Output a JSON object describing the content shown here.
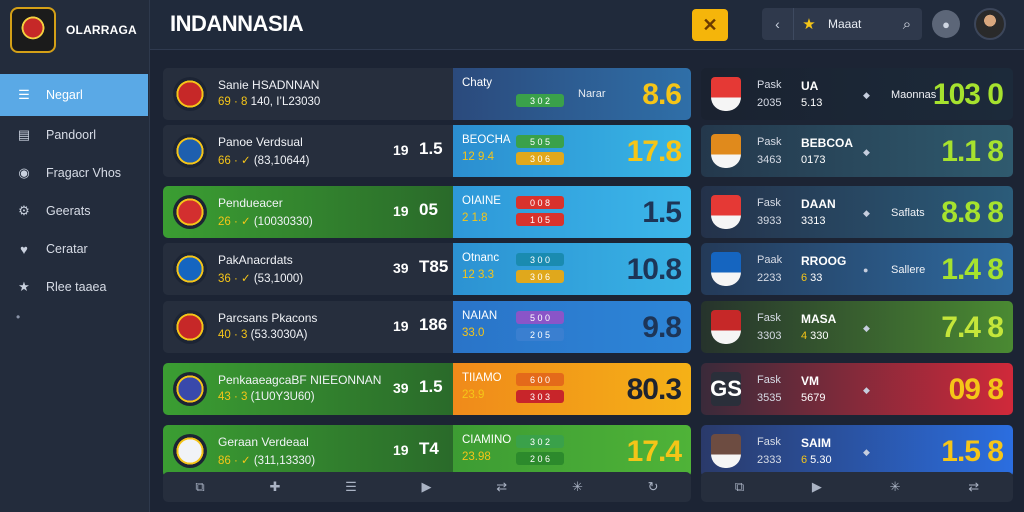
{
  "app": {
    "brand": "OLARRAGA",
    "title": "INDANNASIA"
  },
  "header": {
    "alert_icon": "✕",
    "back_icon": "‹",
    "star_icon": "★",
    "label": "Maaat",
    "search_icon": "⌕",
    "notif_icon": "●"
  },
  "sidebar": {
    "items": [
      {
        "label": "Negarl",
        "icon": "☰",
        "active": true
      },
      {
        "label": "Pandoorl",
        "icon": "▤",
        "active": false
      },
      {
        "label": "Fragacr Vhos",
        "icon": "◉",
        "active": false
      },
      {
        "label": "Geerats",
        "icon": "⚙",
        "active": false
      },
      {
        "label": "Ceratar",
        "icon": "♥",
        "active": false
      },
      {
        "label": "Rlee taaea",
        "icon": "★",
        "active": false
      }
    ],
    "extra": "•"
  },
  "matches": [
    {
      "team": "Sanie HSADNNAN",
      "sub_y": "69 · 8",
      "sub": "140, I’L23030",
      "score1": "",
      "score2": "",
      "odds_tag": "Chaty",
      "odds_tag2": "",
      "pill1": "3 0 2",
      "pill2": "",
      "odds_word": "Narar",
      "odds_big": "8.6",
      "crest": "#c62828",
      "bg": "linear-gradient(90deg,#2b4a7c,#2f6fa8)",
      "big_color": "#f5c518",
      "pill1_color": "#3aa14a",
      "pill2_color": ""
    },
    {
      "team": "Panoe Verdsual",
      "sub_y": "66 · ✓",
      "sub": "(83,10644)",
      "score1": "19",
      "score2": "1.5",
      "odds_tag": "BEOCHA",
      "odds_tag2": "12 9.4",
      "pill1": "5 0 5",
      "pill2": "3 0 6",
      "odds_word": "",
      "odds_big": "17.8",
      "crest": "#1e5fae",
      "bg": "linear-gradient(90deg,#2b8ed0,#38b6e6)",
      "big_color": "#f5c518",
      "pill1_color": "#3aa14a",
      "pill2_color": "#e0a81c"
    },
    {
      "team": "Pendueacer",
      "sub_y": "26 · ✓",
      "sub": "(10030330)",
      "score1": "19",
      "score2": "05",
      "odds_tag": "OIAINE",
      "odds_tag2": "2 1.8",
      "pill1": "0 0 8",
      "pill2": "1 0 5",
      "odds_word": "",
      "odds_big": "1.5",
      "crest": "#d32f2f",
      "bg": "linear-gradient(90deg,#2e98d8,#3cb7ea)",
      "big_color": "#1d3557",
      "pill1_color": "#d9322c",
      "pill2_color": "#d9322c"
    },
    {
      "team": "PakAnacrdats",
      "sub_y": "36 · ✓",
      "sub": "(53,1000)",
      "score1": "39",
      "score2": "T85",
      "odds_tag": "Otnanc",
      "odds_tag2": "12 3.3",
      "pill1": "3 0 0",
      "pill2": "3 0 6",
      "odds_word": "",
      "odds_big": "10.8",
      "crest": "#1565c0",
      "bg": "linear-gradient(90deg,#2c92d2,#39b3e6)",
      "big_color": "#1d3557",
      "pill1_color": "#1a8bb0",
      "pill2_color": "#e0a81c"
    },
    {
      "team": "Parcsans Pkacons",
      "sub_y": "40 · 3",
      "sub": "(53.3030A)",
      "score1": "19",
      "score2": "186",
      "odds_tag": "NAIAN",
      "odds_tag2": "33.0",
      "pill1": "5 0 0",
      "pill2": "2 0 5",
      "odds_word": "",
      "odds_big": "9.8",
      "crest": "#c62828",
      "bg": "linear-gradient(90deg,#2a74c8,#2d86d8)",
      "big_color": "#1d3557",
      "pill1_color": "#8a55c8",
      "pill2_color": "#3a7fd0"
    },
    {
      "team": "PenkaaeagcaBF NIEEONNAN",
      "sub_y": "43 · 3",
      "sub": "(1U0Y3U60)",
      "score1": "39",
      "score2": "1.5",
      "odds_tag": "TIIAMO",
      "odds_tag2": "23.9",
      "pill1": "6 0 0",
      "pill2": "3 0 3",
      "odds_word": "",
      "odds_big": "80.3",
      "crest": "#3949ab",
      "bg": "linear-gradient(90deg,#f08a1a,#f5b117)",
      "big_color": "#1d2330",
      "pill1_color": "#e46a1a",
      "pill2_color": "#c8252a"
    },
    {
      "team": "Geraan Verdeaal",
      "sub_y": "86 · ✓",
      "sub": "(311,13330)",
      "score1": "19",
      "score2": "T4",
      "odds_tag": "CIAMINO",
      "odds_tag2": "23.98",
      "pill1": "3 0 2",
      "pill2": "2 0 6",
      "odds_word": "",
      "odds_big": "17.4",
      "crest": "#f1f3f7",
      "bg": "linear-gradient(90deg,#3d9c33,#4fb338)",
      "big_color": "#f5c518",
      "pill1_color": "#3aa14a",
      "pill2_color": "#2c8a2c"
    }
  ],
  "right_matches": [
    {
      "tag": "Pask",
      "tag2": "2035",
      "name": "UA",
      "sub": "5.13",
      "sub_y": "",
      "word": "Maonnas",
      "big": "103 0",
      "crest": "#e53935",
      "bg": "linear-gradient(90deg,#1a2230,#1c2a3a)",
      "big_color": "#a6e22e",
      "dot": "◆"
    },
    {
      "tag": "Pask",
      "tag2": "3463",
      "name": "BEBCOA",
      "sub": "0173",
      "sub_y": "",
      "word": "",
      "big": "1.1 8",
      "crest": "#e08a1c",
      "bg": "linear-gradient(90deg,#24384c,#2f5a6e)",
      "big_color": "#a6e22e",
      "dot": "◆"
    },
    {
      "tag": "Fask",
      "tag2": "3933",
      "name": "DAAN",
      "sub": "3313",
      "sub_y": "",
      "word": "Saflats",
      "big": "8.8 8",
      "crest": "#e53935",
      "bg": "linear-gradient(90deg,#24324a,#2b5c7a)",
      "big_color": "#a6e22e",
      "dot": "◆"
    },
    {
      "tag": "Paak",
      "tag2": "2233",
      "name": "RROOG",
      "sub": "33",
      "sub_y": "6",
      "word": "Sallere",
      "big": "1.4 8",
      "crest": "#1565c0",
      "bg": "linear-gradient(90deg,#243a58,#2e6aa0)",
      "big_color": "#a6e22e",
      "dot": "●"
    },
    {
      "tag": "Fask",
      "tag2": "3303",
      "name": "MASA",
      "sub": "330",
      "sub_y": "4",
      "word": "",
      "big": "7.4 8",
      "crest": "#c62828",
      "bg": "linear-gradient(90deg,#26332c,#4a8a32)",
      "big_color": "#c5e63a",
      "dot": "◆"
    },
    {
      "tag": "Fask",
      "tag2": "3535",
      "name": "VM",
      "sub": "5679",
      "sub_y": "",
      "word": "",
      "big": "09 8",
      "crest": "#2a2f3a",
      "crest_text": "GS",
      "bg": "linear-gradient(90deg,#3a2a3a,#d0293a)",
      "big_color": "#f5c518",
      "dot": "◆"
    },
    {
      "tag": "Fask",
      "tag2": "2333",
      "name": "SAIM",
      "sub": "5.30",
      "sub_y": "6",
      "word": "",
      "big": "1.5 8",
      "crest": "#6d4c41",
      "bg": "linear-gradient(90deg,#2a3a6a,#2b6ee0)",
      "big_color": "#f5c518",
      "dot": "◆"
    }
  ],
  "toolbar_left": [
    "⧉",
    "✚",
    "☰",
    "▶",
    "⇄",
    "✳",
    "↻"
  ],
  "toolbar_right": [
    "⧉",
    "▶",
    "✳",
    "⇄"
  ]
}
